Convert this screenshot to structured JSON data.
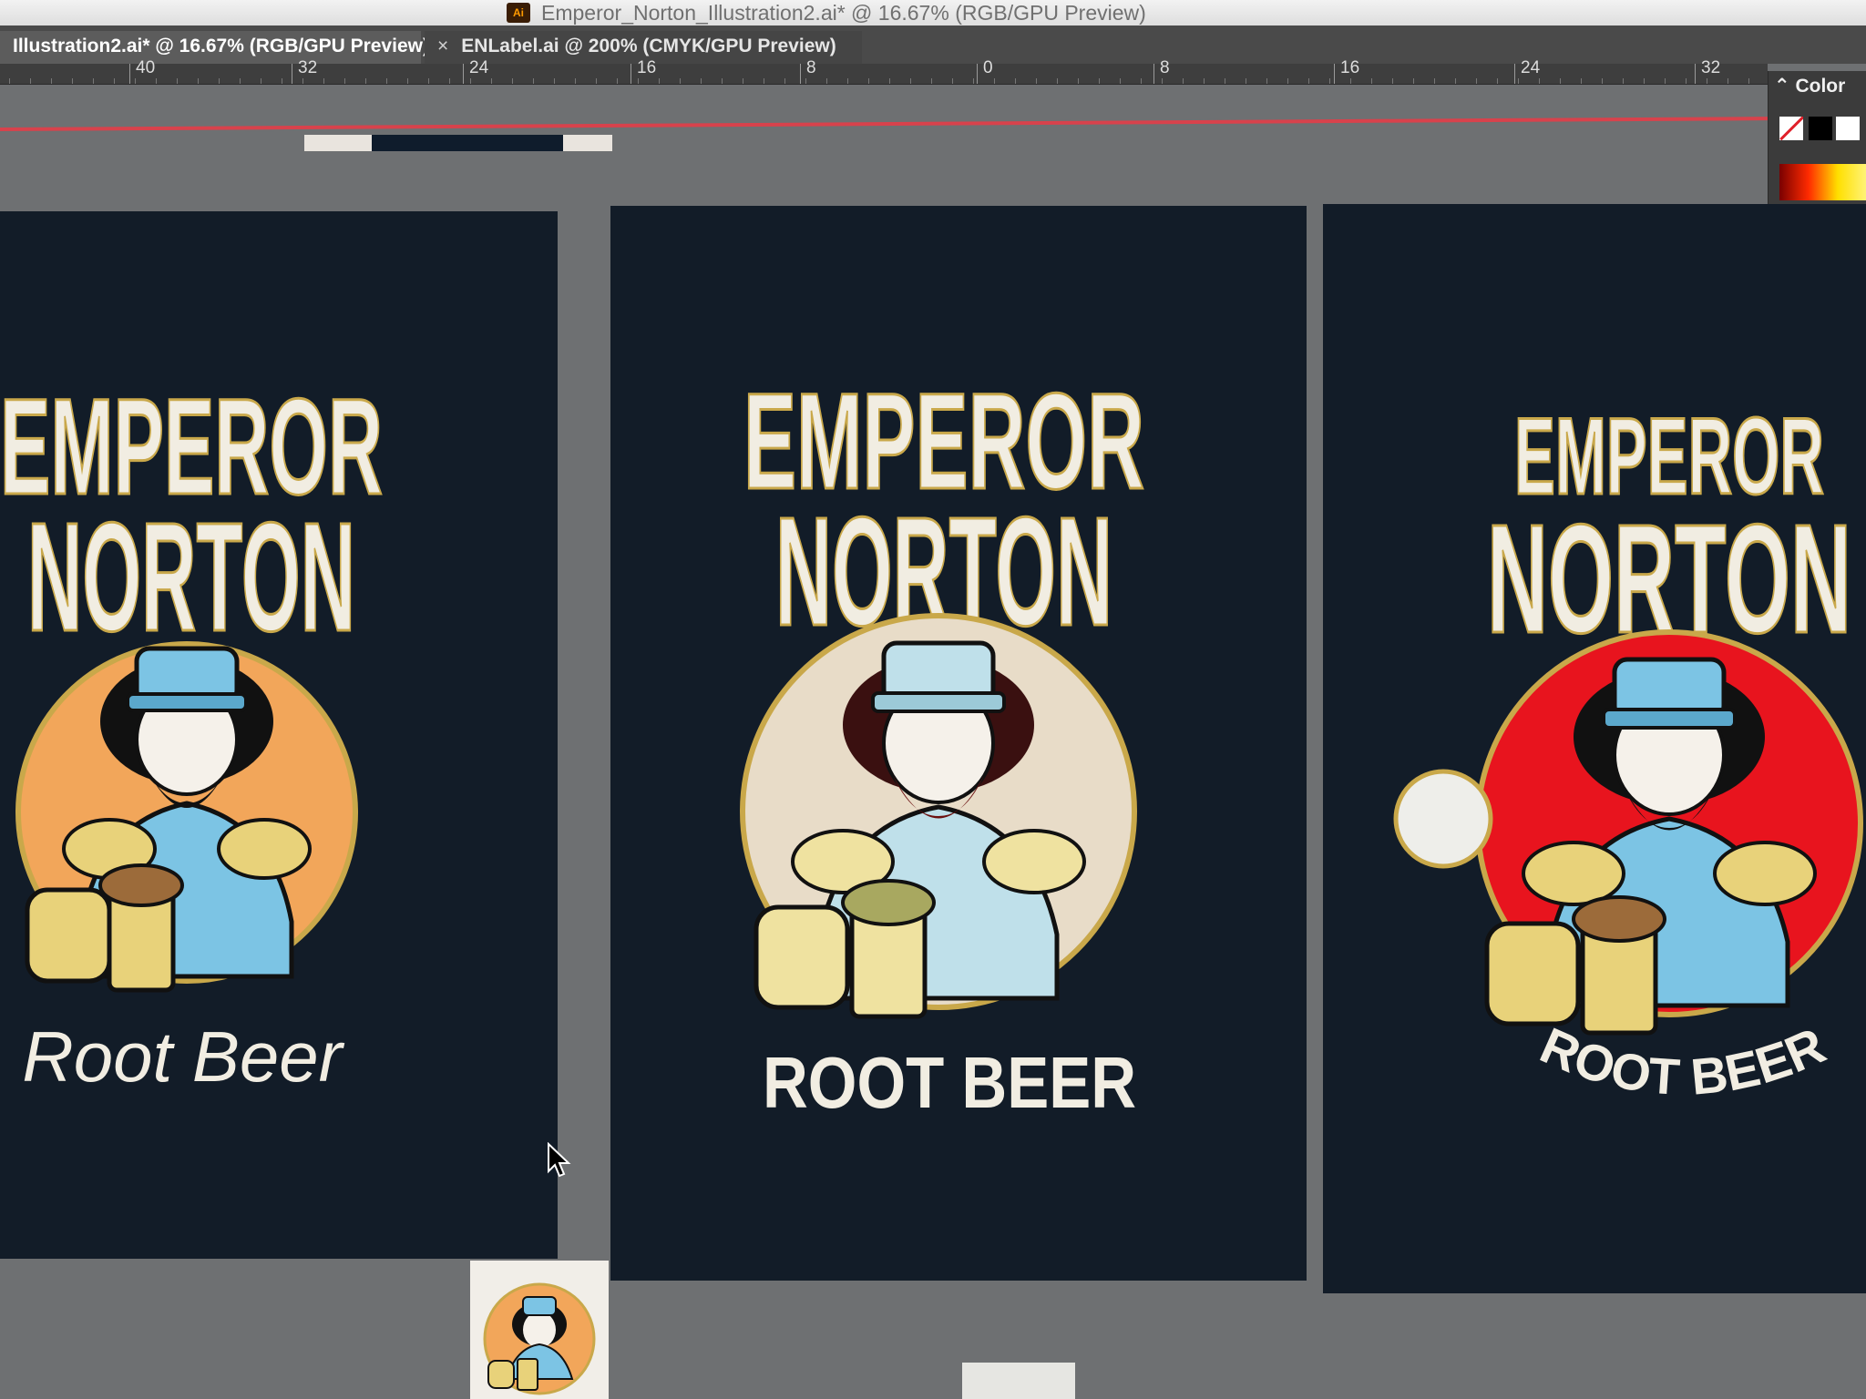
{
  "window": {
    "title": "Emperor_Norton_Illustration2.ai* @ 16.67% (RGB/GPU Preview)",
    "app_icon_label": "Ai"
  },
  "tabs": [
    {
      "label": "Illustration2.ai* @ 16.67% (RGB/GPU Preview)",
      "active": true
    },
    {
      "label": "ENLabel.ai @ 200% (CMYK/GPU Preview)",
      "active": false,
      "close": "×"
    }
  ],
  "ruler": {
    "labels": [
      "40",
      "32",
      "24",
      "16",
      "8",
      "0",
      "8",
      "16",
      "24",
      "32"
    ]
  },
  "color_panel": {
    "title": "Color",
    "toggle_glyph": "⌃"
  },
  "artboards": [
    {
      "id": "left",
      "line1": "EMPEROR",
      "line2": "NORTON",
      "subtitle": "Root Beer",
      "circle_color": "#f2a65a"
    },
    {
      "id": "middle",
      "line1": "EMPEROR",
      "line2": "NORTON",
      "subtitle": "ROOT BEER",
      "circle_color": "#e8dcc8"
    },
    {
      "id": "right",
      "line1": "EMPEROR",
      "line2": "NORTON",
      "subtitle": "ROOT BEER",
      "circle_color": "#e8141e"
    }
  ],
  "colors": {
    "navy": "#121c28",
    "cream": "#f1ede2",
    "gold": "#c9a84a",
    "skyblue": "#7cc4e4",
    "mug": "#e8d27a",
    "guide": "#d8424c"
  }
}
